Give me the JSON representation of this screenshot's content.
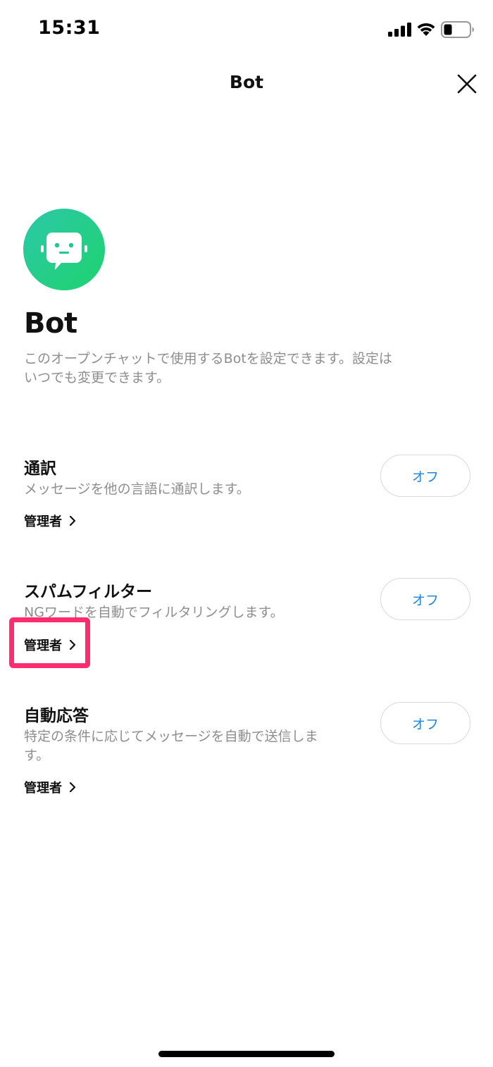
{
  "status_bar": {
    "time": "15:31",
    "icons": [
      "signal-icon",
      "wifi-icon",
      "battery-icon"
    ]
  },
  "nav": {
    "title": "Bot",
    "close_icon": "close-icon"
  },
  "hero": {
    "avatar_icon": "bot-icon",
    "title": "Bot",
    "description": "このオープンチャットで使用するBotを設定できます。設定はいつでも変更できます。"
  },
  "settings": [
    {
      "title": "通訳",
      "description": "メッセージを他の言語に通訳します。",
      "admin_label": "管理者",
      "toggle_label": "オフ"
    },
    {
      "title": "スパムフィルター",
      "description": "NGワードを自動でフィルタリングします。",
      "admin_label": "管理者",
      "toggle_label": "オフ"
    },
    {
      "title": "自動応答",
      "description": "特定の条件に応じてメッセージを自動で送信します。",
      "admin_label": "管理者",
      "toggle_label": "オフ"
    }
  ],
  "colors": {
    "accent_blue": "#1f86e6",
    "avatar_gradient_start": "#2cc8a8",
    "avatar_gradient_end": "#1ed36e",
    "highlight": "#ff2d6f",
    "secondary_text": "#8e8e8e"
  }
}
